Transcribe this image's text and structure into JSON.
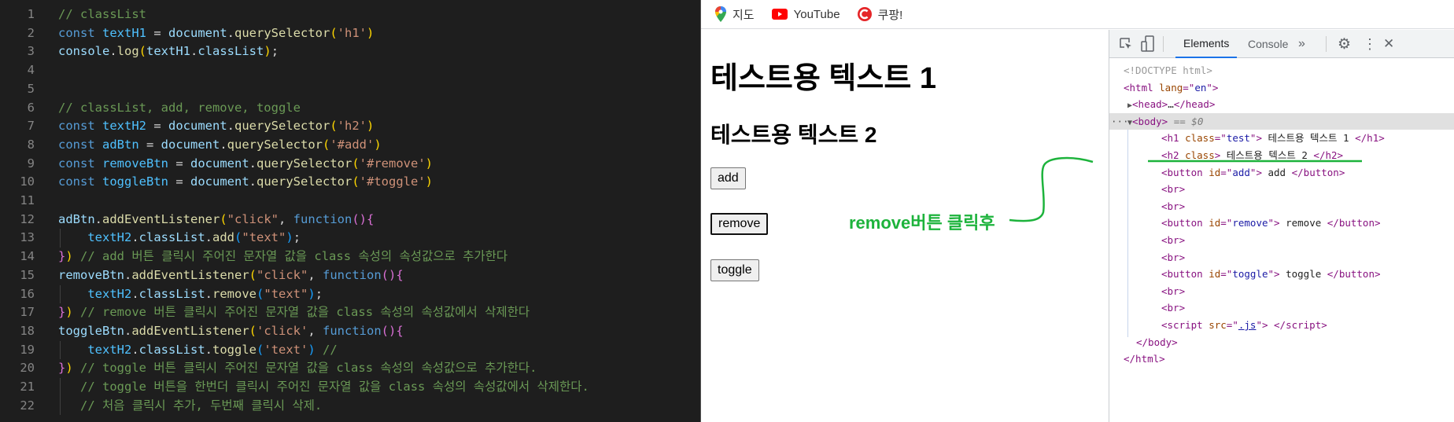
{
  "editor": {
    "lines": [
      [
        [
          "// classList",
          "c"
        ]
      ],
      [
        [
          "const ",
          "k"
        ],
        [
          "textH1",
          "vv"
        ],
        [
          " = ",
          "p"
        ],
        [
          "document",
          "v"
        ],
        [
          ".",
          "p"
        ],
        [
          "querySelector",
          "f"
        ],
        [
          "(",
          "b1"
        ],
        [
          "'h1'",
          "s"
        ],
        [
          ")",
          "b1"
        ]
      ],
      [
        [
          "console",
          "v"
        ],
        [
          ".",
          "p"
        ],
        [
          "log",
          "f"
        ],
        [
          "(",
          "b1"
        ],
        [
          "textH1",
          "v"
        ],
        [
          ".",
          "p"
        ],
        [
          "classList",
          "v"
        ],
        [
          ")",
          "b1"
        ],
        [
          ";",
          "p"
        ]
      ],
      [],
      [],
      [
        [
          "// classList, add, remove, toggle",
          "c"
        ]
      ],
      [
        [
          "const ",
          "k"
        ],
        [
          "textH2",
          "vv"
        ],
        [
          " = ",
          "p"
        ],
        [
          "document",
          "v"
        ],
        [
          ".",
          "p"
        ],
        [
          "querySelector",
          "f"
        ],
        [
          "(",
          "b1"
        ],
        [
          "'h2'",
          "s"
        ],
        [
          ")",
          "b1"
        ]
      ],
      [
        [
          "const ",
          "k"
        ],
        [
          "adBtn",
          "vv"
        ],
        [
          " = ",
          "p"
        ],
        [
          "document",
          "v"
        ],
        [
          ".",
          "p"
        ],
        [
          "querySelector",
          "f"
        ],
        [
          "(",
          "b1"
        ],
        [
          "'#add'",
          "s"
        ],
        [
          ")",
          "b1"
        ]
      ],
      [
        [
          "const ",
          "k"
        ],
        [
          "removeBtn",
          "vv"
        ],
        [
          " = ",
          "p"
        ],
        [
          "document",
          "v"
        ],
        [
          ".",
          "p"
        ],
        [
          "querySelector",
          "f"
        ],
        [
          "(",
          "b1"
        ],
        [
          "'#remove'",
          "s"
        ],
        [
          ")",
          "b1"
        ]
      ],
      [
        [
          "const ",
          "k"
        ],
        [
          "toggleBtn",
          "vv"
        ],
        [
          " = ",
          "p"
        ],
        [
          "document",
          "v"
        ],
        [
          ".",
          "p"
        ],
        [
          "querySelector",
          "f"
        ],
        [
          "(",
          "b1"
        ],
        [
          "'#toggle'",
          "s"
        ],
        [
          ")",
          "b1"
        ]
      ],
      [],
      [
        [
          "adBtn",
          "v"
        ],
        [
          ".",
          "p"
        ],
        [
          "addEventListener",
          "f"
        ],
        [
          "(",
          "b1"
        ],
        [
          "\"click\"",
          "s"
        ],
        [
          ", ",
          "p"
        ],
        [
          "function",
          "k"
        ],
        [
          "()",
          "b2"
        ],
        [
          "{",
          "b2"
        ]
      ],
      [
        [
          "    ",
          "p"
        ],
        [
          "textH2",
          "vv"
        ],
        [
          ".",
          "p"
        ],
        [
          "classList",
          "v"
        ],
        [
          ".",
          "p"
        ],
        [
          "add",
          "f"
        ],
        [
          "(",
          "b3"
        ],
        [
          "\"text\"",
          "s"
        ],
        [
          ")",
          "b3"
        ],
        [
          ";",
          "p"
        ]
      ],
      [
        [
          "}",
          "b2"
        ],
        [
          ")",
          "b1"
        ],
        [
          " // add 버튼 클릭시 주어진 문자열 값을 class 속성의 속성값으로 추가한다",
          "c"
        ]
      ],
      [
        [
          "removeBtn",
          "v"
        ],
        [
          ".",
          "p"
        ],
        [
          "addEventListener",
          "f"
        ],
        [
          "(",
          "b1"
        ],
        [
          "\"click\"",
          "s"
        ],
        [
          ", ",
          "p"
        ],
        [
          "function",
          "k"
        ],
        [
          "()",
          "b2"
        ],
        [
          "{",
          "b2"
        ]
      ],
      [
        [
          "    ",
          "p"
        ],
        [
          "textH2",
          "vv"
        ],
        [
          ".",
          "p"
        ],
        [
          "classList",
          "v"
        ],
        [
          ".",
          "p"
        ],
        [
          "remove",
          "f"
        ],
        [
          "(",
          "b3"
        ],
        [
          "\"text\"",
          "s"
        ],
        [
          ")",
          "b3"
        ],
        [
          ";",
          "p"
        ]
      ],
      [
        [
          "}",
          "b2"
        ],
        [
          ")",
          "b1"
        ],
        [
          " // remove 버튼 클릭시 주어진 문자열 값을 class 속성의 속성값에서 삭제한다",
          "c"
        ]
      ],
      [
        [
          "toggleBtn",
          "v"
        ],
        [
          ".",
          "p"
        ],
        [
          "addEventListener",
          "f"
        ],
        [
          "(",
          "b1"
        ],
        [
          "'click'",
          "s"
        ],
        [
          ", ",
          "p"
        ],
        [
          "function",
          "k"
        ],
        [
          "()",
          "b2"
        ],
        [
          "{",
          "b2"
        ]
      ],
      [
        [
          "    ",
          "p"
        ],
        [
          "textH2",
          "vv"
        ],
        [
          ".",
          "p"
        ],
        [
          "classList",
          "v"
        ],
        [
          ".",
          "p"
        ],
        [
          "toggle",
          "f"
        ],
        [
          "(",
          "b3"
        ],
        [
          "'text'",
          "s"
        ],
        [
          ")",
          "b3"
        ],
        [
          " //",
          "c"
        ]
      ],
      [
        [
          "}",
          "b2"
        ],
        [
          ")",
          "b1"
        ],
        [
          " // toggle 버튼 클릭시 주어진 문자열 값을 class 속성의 속성값으로 추가한다.",
          "c"
        ]
      ],
      [
        [
          "   // toggle 버튼을 한번더 클릭시 주어진 문자열 값을 class 속성의 속성값에서 삭제한다.",
          "c"
        ]
      ],
      [
        [
          "   // 처음 클릭시 추가, 두번째 클릭시 삭제.",
          "c"
        ]
      ]
    ]
  },
  "bookmarks": [
    {
      "label": "지도",
      "icon": "maps-pin-icon"
    },
    {
      "label": "YouTube",
      "icon": "youtube-icon"
    },
    {
      "label": "쿠팡!",
      "icon": "coupang-icon"
    }
  ],
  "page": {
    "h1": "테스트용 텍스트 1",
    "h2": "테스트용 텍스트 2",
    "buttons": {
      "add": "add",
      "remove": "remove",
      "toggle": "toggle"
    },
    "annotation": "remove버튼 클릭후",
    "annotation_color": "#1db33c"
  },
  "devtools": {
    "tabs": {
      "elements": "Elements",
      "console": "Console",
      "more": "»"
    },
    "tree": [
      {
        "indent": 0,
        "tokens": [
          [
            "<!DOCTYPE html>",
            "g"
          ]
        ]
      },
      {
        "indent": 0,
        "tokens": [
          [
            "<html ",
            "t"
          ],
          [
            "lang",
            "an"
          ],
          [
            "=\"",
            "t"
          ],
          [
            "en",
            "av"
          ],
          [
            "\">",
            "t"
          ]
        ]
      },
      {
        "indent": 1,
        "arrow": "▶",
        "tokens": [
          [
            "<head>",
            "t"
          ],
          [
            "…",
            "tx"
          ],
          [
            "</head>",
            "t"
          ]
        ]
      },
      {
        "indent": 1,
        "arrow": "▼",
        "selected": true,
        "tokens": [
          [
            "<body>",
            "t"
          ],
          [
            " == $0",
            "dim"
          ]
        ]
      },
      {
        "indent": 2,
        "tokens": [
          [
            "<h1 ",
            "t"
          ],
          [
            "class",
            "an"
          ],
          [
            "=\"",
            "t"
          ],
          [
            "test",
            "av"
          ],
          [
            "\">",
            "t"
          ],
          [
            " 테스트용 텍스트 1 ",
            "tx"
          ],
          [
            "</h1>",
            "t"
          ]
        ]
      },
      {
        "indent": 2,
        "tokens": [
          [
            "<h2 ",
            "t"
          ],
          [
            "class",
            "an"
          ],
          [
            ">",
            "t"
          ],
          [
            " 테스트용 텍스트 2 ",
            "tx"
          ],
          [
            "</h2>",
            "t"
          ]
        ]
      },
      {
        "indent": 2,
        "tokens": [
          [
            "<button ",
            "t"
          ],
          [
            "id",
            "an"
          ],
          [
            "=\"",
            "t"
          ],
          [
            "add",
            "av"
          ],
          [
            "\">",
            "t"
          ],
          [
            " add ",
            "tx"
          ],
          [
            "</button>",
            "t"
          ]
        ]
      },
      {
        "indent": 2,
        "tokens": [
          [
            "<br>",
            "t"
          ]
        ]
      },
      {
        "indent": 2,
        "tokens": [
          [
            "<br>",
            "t"
          ]
        ]
      },
      {
        "indent": 2,
        "tokens": [
          [
            "<button ",
            "t"
          ],
          [
            "id",
            "an"
          ],
          [
            "=\"",
            "t"
          ],
          [
            "remove",
            "av"
          ],
          [
            "\">",
            "t"
          ],
          [
            " remove ",
            "tx"
          ],
          [
            "</button>",
            "t"
          ]
        ]
      },
      {
        "indent": 2,
        "tokens": [
          [
            "<br>",
            "t"
          ]
        ]
      },
      {
        "indent": 2,
        "tokens": [
          [
            "<br>",
            "t"
          ]
        ]
      },
      {
        "indent": 2,
        "tokens": [
          [
            "<button ",
            "t"
          ],
          [
            "id",
            "an"
          ],
          [
            "=\"",
            "t"
          ],
          [
            "toggle",
            "av"
          ],
          [
            "\">",
            "t"
          ],
          [
            " toggle ",
            "tx"
          ],
          [
            "</button>",
            "t"
          ]
        ]
      },
      {
        "indent": 2,
        "tokens": [
          [
            "<br>",
            "t"
          ]
        ]
      },
      {
        "indent": 2,
        "tokens": [
          [
            "<br>",
            "t"
          ]
        ]
      },
      {
        "indent": 2,
        "tokens": [
          [
            "<script ",
            "t"
          ],
          [
            "src",
            "an"
          ],
          [
            "=\"",
            "t"
          ],
          [
            ".js",
            "lk"
          ],
          [
            "\">",
            "t"
          ],
          [
            " ",
            "tx"
          ],
          [
            "</script>",
            "t"
          ]
        ]
      },
      {
        "indent": 1,
        "tokens": [
          [
            "</body>",
            "t"
          ]
        ]
      },
      {
        "indent": 0,
        "tokens": [
          [
            "</html>",
            "t"
          ]
        ]
      }
    ]
  }
}
